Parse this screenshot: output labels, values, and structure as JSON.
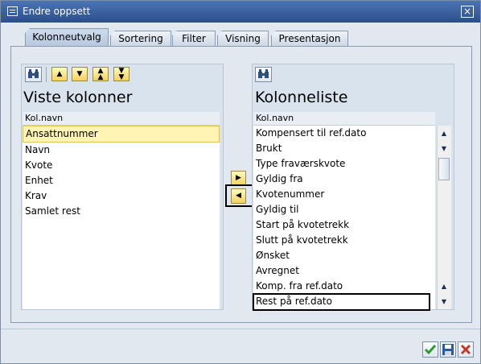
{
  "window": {
    "title": "Endre oppsett",
    "close_label": "×"
  },
  "tabs": [
    {
      "label": "Kolonneutvalg",
      "active": true
    },
    {
      "label": "Sortering",
      "active": false
    },
    {
      "label": "Filter",
      "active": false
    },
    {
      "label": "Visning",
      "active": false
    },
    {
      "label": "Presentasjon",
      "active": false
    }
  ],
  "left_panel": {
    "heading": "Viste kolonner",
    "column_header": "Kol.navn",
    "items": [
      "Ansattnummer",
      "Navn",
      "Kvote",
      "Enhet",
      "Krav",
      "Samlet rest"
    ],
    "selected_index": 0,
    "toolbar_icons": [
      "find-icon",
      "move-up-icon",
      "move-down-icon",
      "move-top-icon",
      "move-bottom-icon"
    ]
  },
  "right_panel": {
    "heading": "Kolonneliste",
    "column_header": "Kol.navn",
    "items": [
      "Kompensert til ref.dato",
      "Brukt",
      "Type fraværskvote",
      "Gyldig fra",
      "Kvotenummer",
      "Gyldig til",
      "Start på kvotetrekk",
      "Slutt på kvotetrekk",
      "Ønsket",
      "Avregnet",
      "Komp. fra ref.dato",
      "Rest på ref.dato"
    ],
    "highlighted_index": 11,
    "toolbar_icons": [
      "find-icon"
    ]
  },
  "transfer": {
    "right_icon": "arrow-right-icon",
    "left_icon": "arrow-left-icon"
  },
  "footer": {
    "icons": [
      "confirm-check-icon",
      "save-icon",
      "cancel-icon"
    ]
  },
  "colors": {
    "title_bar": "#2f5597",
    "selection": "#fff4b3",
    "button_gold": "#f2d25a",
    "cancel_red": "#c0392b",
    "confirm_green": "#2e9b2e"
  }
}
